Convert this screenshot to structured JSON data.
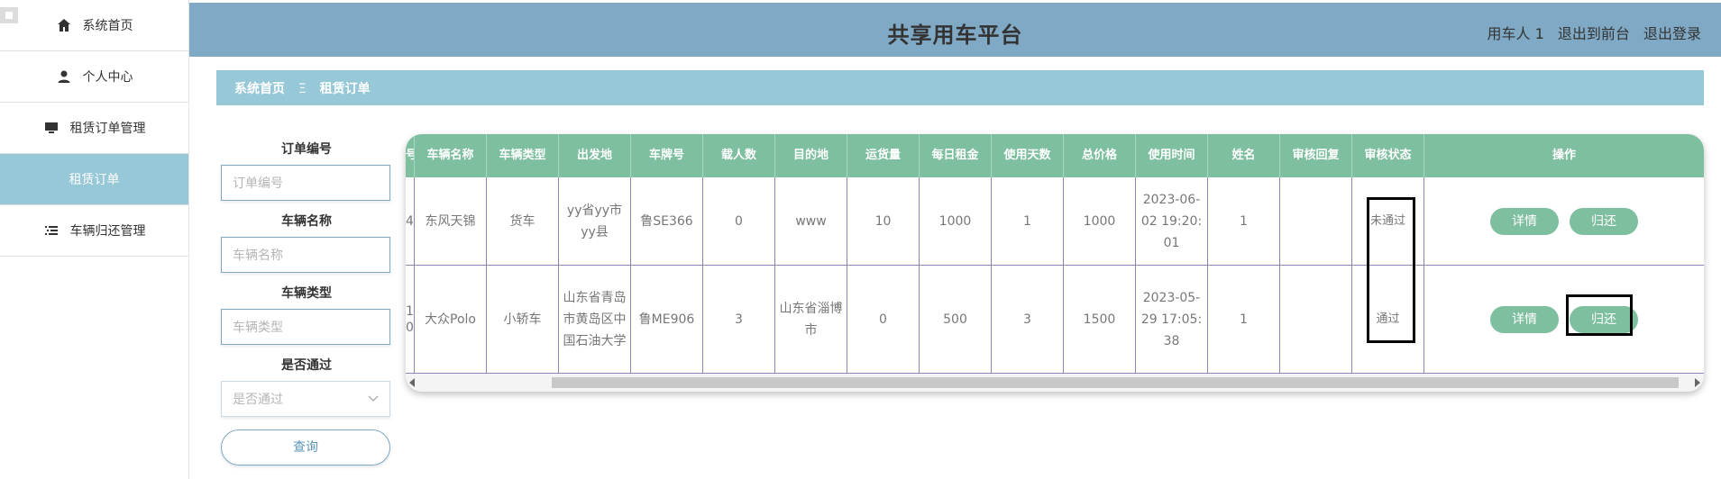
{
  "sidebar": {
    "items": [
      {
        "label": "系统首页",
        "icon": "home-icon"
      },
      {
        "label": "个人中心",
        "icon": "user-icon"
      },
      {
        "label": "租赁订单管理",
        "icon": "monitor-icon"
      },
      {
        "label": "租赁订单",
        "icon": "",
        "active": true
      },
      {
        "label": "车辆归还管理",
        "icon": "list-icon"
      }
    ]
  },
  "header": {
    "title": "共享用车平台",
    "user": "用车人 1",
    "back_to_front": "退出到前台",
    "logout": "退出登录"
  },
  "breadcrumb": {
    "home": "系统首页",
    "sep": "Ξ",
    "current": "租赁订单"
  },
  "search": {
    "order_no_label": "订单编号",
    "order_no_placeholder": "订单编号",
    "car_name_label": "车辆名称",
    "car_name_placeholder": "车辆名称",
    "car_type_label": "车辆类型",
    "car_type_placeholder": "车辆类型",
    "passed_label": "是否通过",
    "passed_placeholder": "是否通过",
    "query_button": "查询"
  },
  "table": {
    "headers": [
      "号",
      "车辆名称",
      "车辆类型",
      "出发地",
      "车牌号",
      "载人数",
      "目的地",
      "运货量",
      "每日租金",
      "使用天数",
      "总价格",
      "使用时间",
      "姓名",
      "审核回复",
      "审核状态",
      "操作"
    ],
    "rows": [
      {
        "cells": [
          "4",
          "东风天锦",
          "货车",
          "yy省yy市yy县",
          "鲁SE366",
          "0",
          "www",
          "10",
          "1000",
          "1",
          "1000",
          "2023-06-02 19:20:01",
          "1",
          "",
          "未通过"
        ]
      },
      {
        "cells": [
          "1\n0",
          "大众Polo",
          "小轿车",
          "山东省青岛市黄岛区中国石油大学",
          "鲁ME906",
          "3",
          "山东省淄博市",
          "0",
          "500",
          "3",
          "1500",
          "2023-05-29 17:05:38",
          "1",
          "",
          "通过"
        ]
      }
    ],
    "detail_label": "详情",
    "return_label": "归还"
  },
  "colors": {
    "header_bg": "#7fa9c4",
    "sidebar_active": "#96c8d7",
    "table_header": "#7dbf9f",
    "button": "#7dbf9f"
  }
}
